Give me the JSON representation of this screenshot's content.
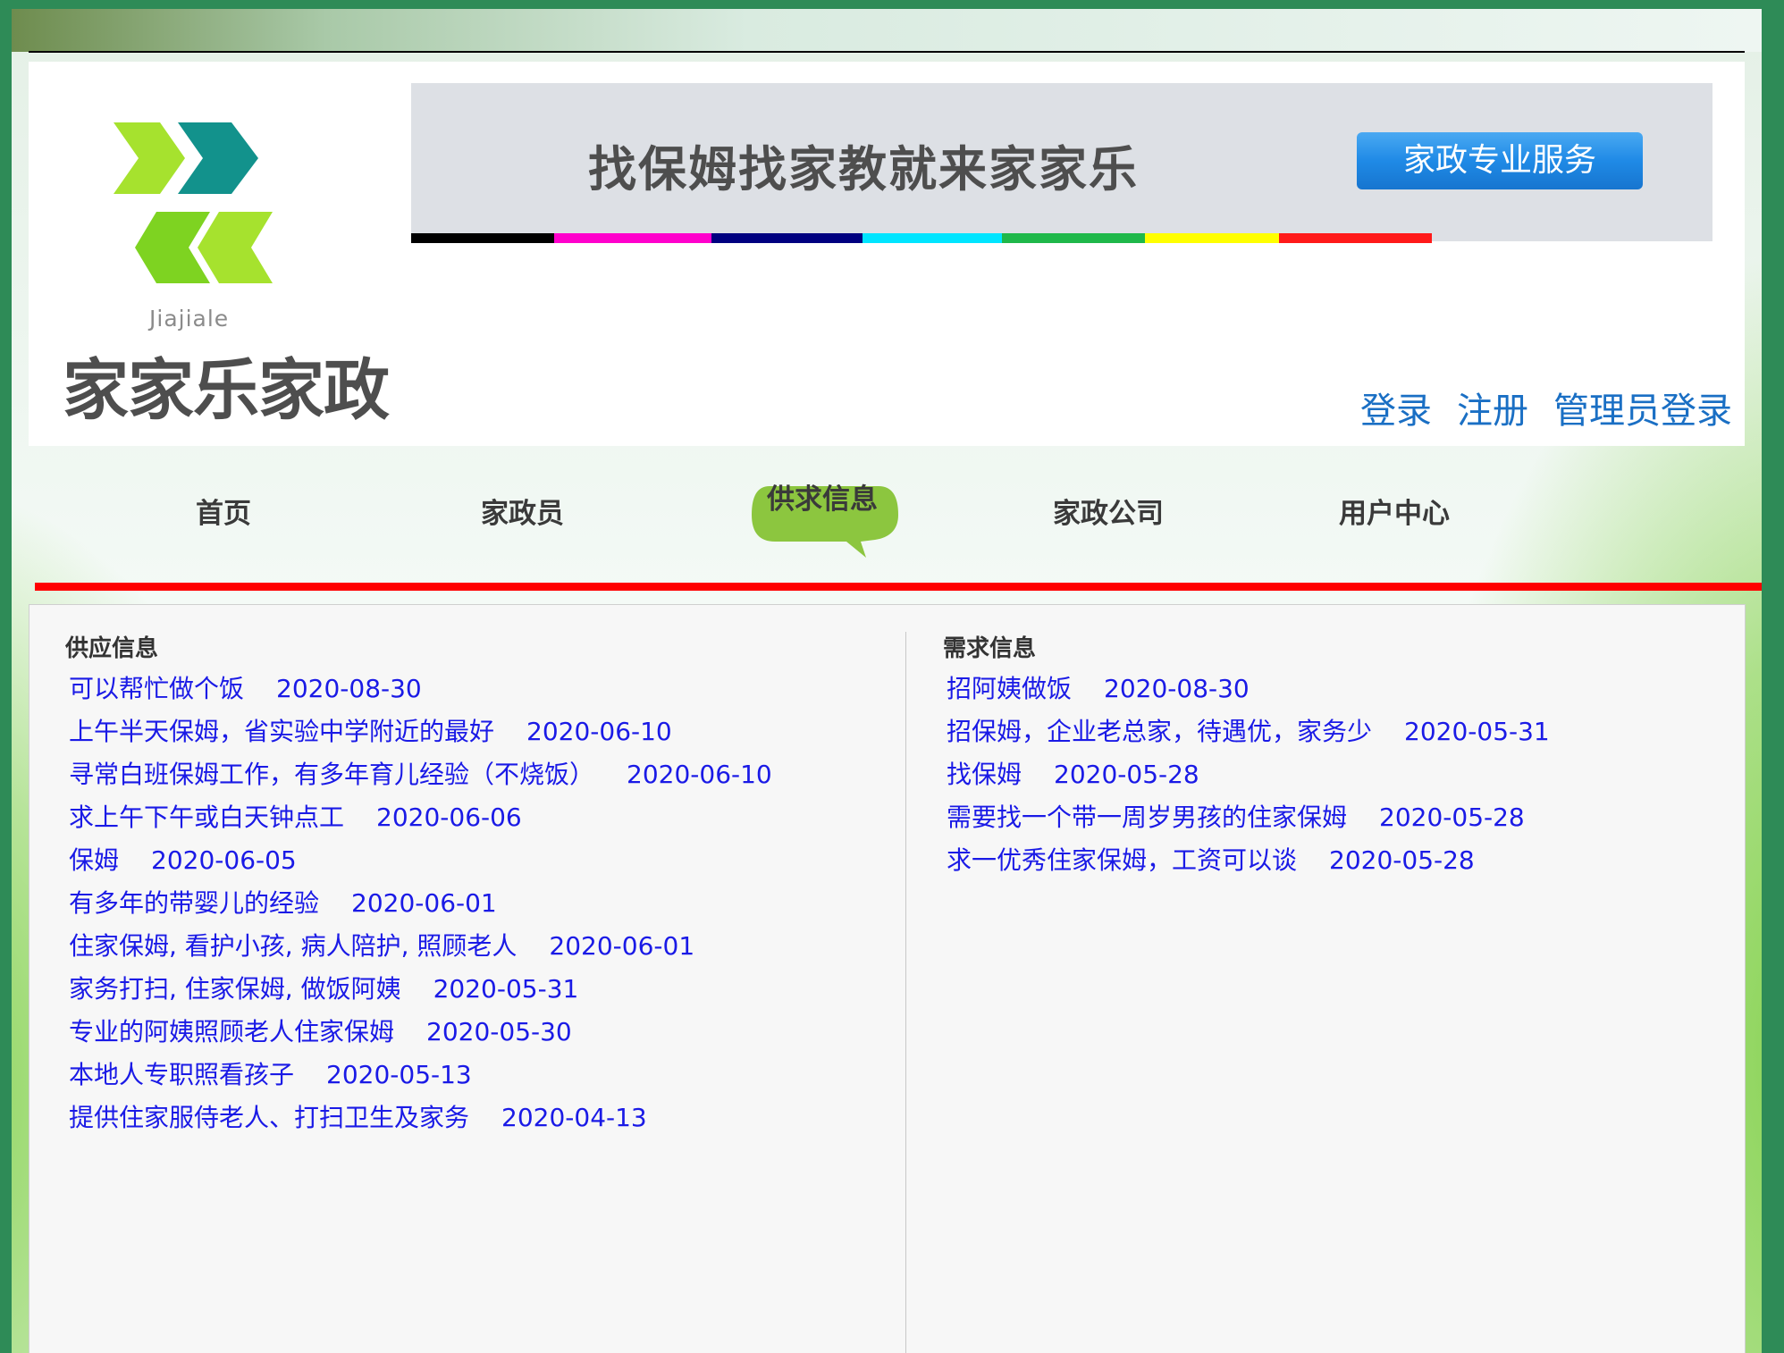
{
  "site": {
    "logo_subtext": "Jiajiale",
    "logo_name": "家家乐家政",
    "banner_slogan": "找保姆找家教就来家家乐",
    "banner_badge": "家政专业服务",
    "banner_stripe_colors": [
      "#000000",
      "#ff00cc",
      "#000080",
      "#00e5ff",
      "#1fb84a",
      "#ffff00",
      "#ff1a1a"
    ]
  },
  "auth": {
    "login": "登录",
    "register": "注册",
    "admin_login": "管理员登录"
  },
  "nav": {
    "items": [
      {
        "label": "首页",
        "active": false
      },
      {
        "label": "家政员",
        "active": false
      },
      {
        "label": "供求信息",
        "active": true
      },
      {
        "label": "家政公司",
        "active": false
      },
      {
        "label": "用户中心",
        "active": false
      }
    ]
  },
  "supply": {
    "title": "供应信息",
    "items": [
      {
        "title": "可以帮忙做个饭",
        "date": "2020-08-30"
      },
      {
        "title": "上午半天保姆，省实验中学附近的最好",
        "date": "2020-06-10"
      },
      {
        "title": "寻常白班保姆工作，有多年育儿经验（不烧饭）",
        "date": "2020-06-10"
      },
      {
        "title": "求上午下午或白天钟点工",
        "date": "2020-06-06"
      },
      {
        "title": "保姆",
        "date": "2020-06-05"
      },
      {
        "title": "有多年的带婴儿的经验",
        "date": "2020-06-01"
      },
      {
        "title": "住家保姆, 看护小孩, 病人陪护, 照顾老人",
        "date": "2020-06-01"
      },
      {
        "title": "家务打扫, 住家保姆, 做饭阿姨",
        "date": "2020-05-31"
      },
      {
        "title": "专业的阿姨照顾老人住家保姆",
        "date": "2020-05-30"
      },
      {
        "title": "本地人专职照看孩子",
        "date": "2020-05-13"
      },
      {
        "title": "提供住家服侍老人、打扫卫生及家务",
        "date": "2020-04-13"
      }
    ]
  },
  "demand": {
    "title": "需求信息",
    "items": [
      {
        "title": "招阿姨做饭",
        "date": "2020-08-30"
      },
      {
        "title": "招保姆，企业老总家，待遇优，家务少",
        "date": "2020-05-31"
      },
      {
        "title": "找保姆",
        "date": "2020-05-28"
      },
      {
        "title": "需要找一个带一周岁男孩的住家保姆",
        "date": "2020-05-28"
      },
      {
        "title": "求一优秀住家保姆，工资可以谈",
        "date": "2020-05-28"
      }
    ]
  },
  "colors": {
    "link": "#1a1ae6",
    "auth_link": "#1a6fc4",
    "nav_active_bubble": "#8cc63f",
    "nav_red_line": "#ff0000",
    "badge_blue": "#1f8ae6"
  }
}
